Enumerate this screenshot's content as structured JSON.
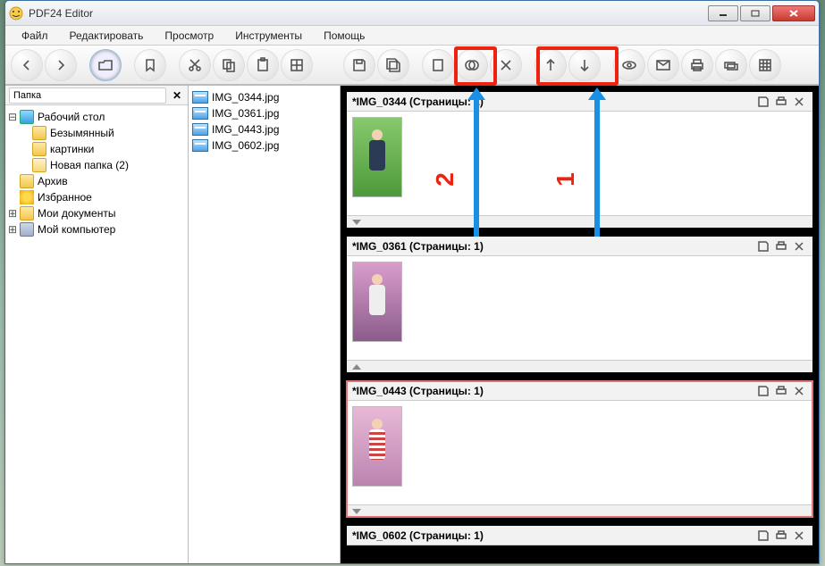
{
  "window": {
    "title": "PDF24 Editor"
  },
  "menu": {
    "items": [
      "Файл",
      "Редактировать",
      "Просмотр",
      "Инструменты",
      "Помощь"
    ]
  },
  "tree": {
    "header": "Папка",
    "root": "Рабочий стол",
    "folders": [
      "Безымянный",
      "картинки",
      "Новая папка (2)"
    ],
    "archives": "Архив",
    "favorites": "Избранное",
    "mydocs": "Мои документы",
    "mypc": "Мой компьютер"
  },
  "files": [
    "IMG_0344.jpg",
    "IMG_0361.jpg",
    "IMG_0443.jpg",
    "IMG_0602.jpg"
  ],
  "docs": [
    {
      "title": "*IMG_0344 (Страницы: 1)"
    },
    {
      "title": "*IMG_0361 (Страницы: 1)"
    },
    {
      "title": "*IMG_0443 (Страницы: 1)"
    },
    {
      "title": "*IMG_0602 (Страницы: 1)"
    }
  ],
  "annotations": {
    "n1": "1",
    "n2": "2"
  }
}
